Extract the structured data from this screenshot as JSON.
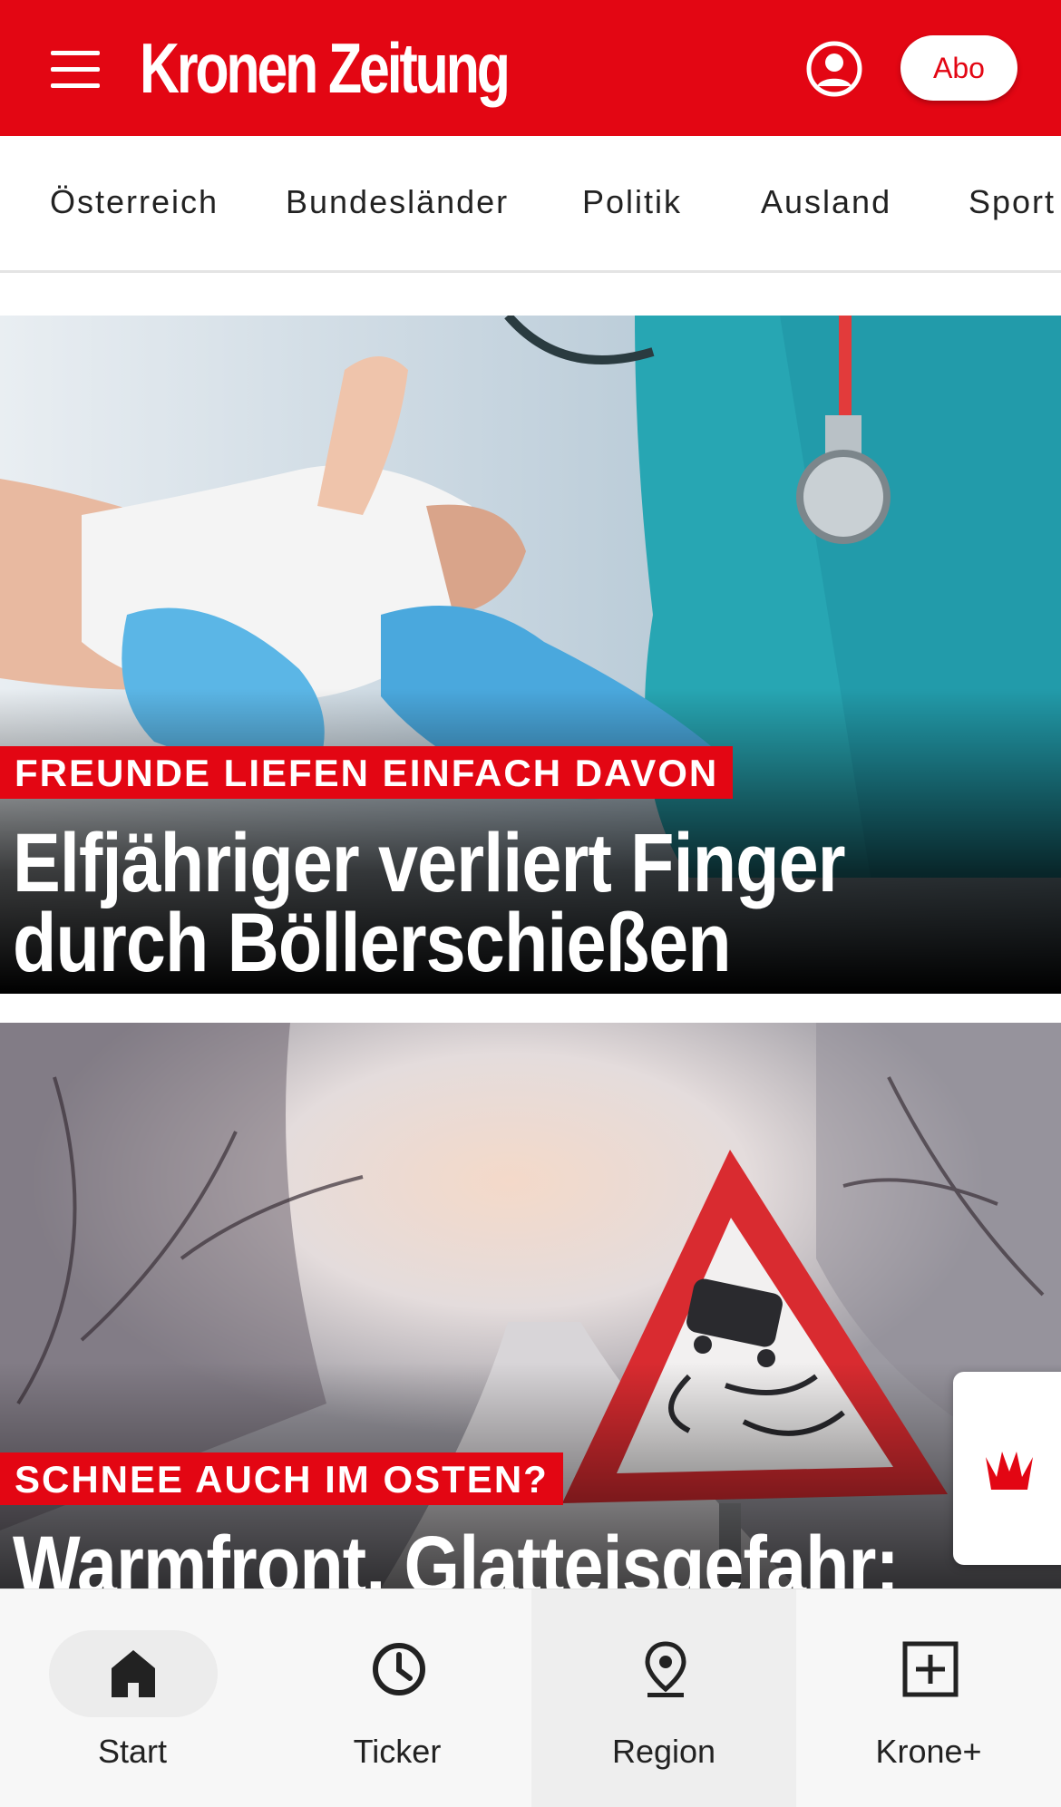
{
  "header": {
    "logo_text": "Kronen Zeitung",
    "abo_label": "Abo",
    "brand_color": "#e30613"
  },
  "categories": [
    "Österreich",
    "Bundesländer",
    "Politik",
    "Ausland",
    "Sport"
  ],
  "articles": [
    {
      "kicker": "FREUNDE LIEFEN EINFACH DAVON",
      "headline_line1": "Elfjähriger verliert Finger",
      "headline_line2": "durch Böllerschießen"
    },
    {
      "kicker": "SCHNEE AUCH IM OSTEN?",
      "headline_line1": "Warmfront, Glatteisgefahr:"
    }
  ],
  "bottom_nav": {
    "start_label": "Start",
    "ticker_label": "Ticker",
    "region_label": "Region",
    "kroneplus_label": "Krone+"
  },
  "icons": {
    "menu": "hamburger-icon",
    "account": "user-circle-icon",
    "fab": "crown-icon",
    "start": "home-icon",
    "ticker": "clock-icon",
    "region": "location-pin-icon",
    "kroneplus": "plus-square-icon"
  }
}
